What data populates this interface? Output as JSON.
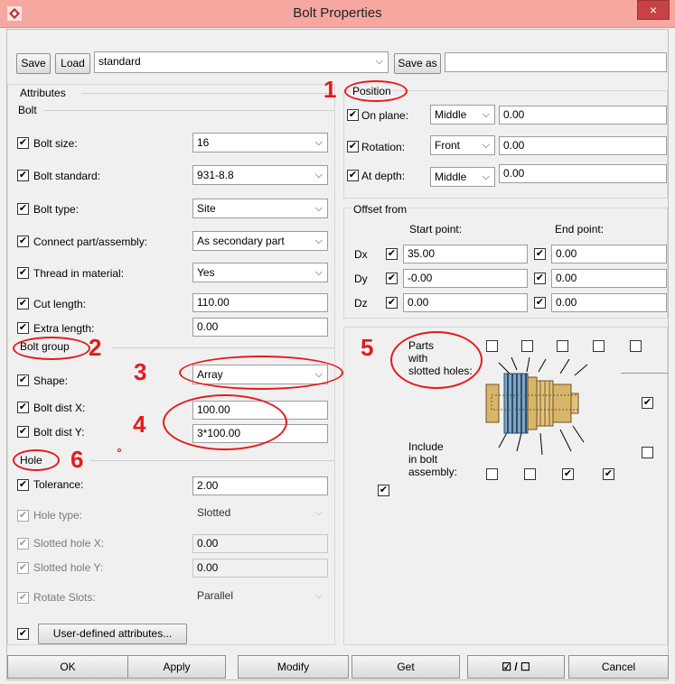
{
  "window": {
    "title": "Bolt Properties",
    "close_glyph": "×"
  },
  "toolbar": {
    "save_label": "Save",
    "load_label": "Load",
    "preset_value": "standard",
    "save_as_label": "Save as",
    "save_as_value": ""
  },
  "attributes": {
    "section_label": "Attributes",
    "bolt_label": "Bolt"
  },
  "bolt_rows": [
    {
      "label": "Bolt size:",
      "value": "16"
    },
    {
      "label": "Bolt standard:",
      "value": "931-8.8"
    },
    {
      "label": "Bolt type:",
      "value": "Site"
    },
    {
      "label": "Connect part/assembly:",
      "value": "As secondary part"
    },
    {
      "label": "Thread in material:",
      "value": "Yes"
    },
    {
      "label": "Cut length:",
      "value": "110.00"
    },
    {
      "label": "Extra length:",
      "value": "0.00"
    }
  ],
  "bolt_group": {
    "label": "Bolt group",
    "shape_label": "Shape:",
    "shape_value": "Array",
    "dist_x_label": "Bolt dist X:",
    "dist_x_value": "100.00",
    "dist_y_label": "Bolt dist Y:",
    "dist_y_value": "3*100.00"
  },
  "hole": {
    "label": "Hole",
    "tolerance_label": "Tolerance:",
    "tolerance_value": "2.00",
    "hole_type_label": "Hole type:",
    "hole_type_value": "Slotted",
    "slotted_x_label": "Slotted hole X:",
    "slotted_x_value": "0.00",
    "slotted_y_label": "Slotted hole Y:",
    "slotted_y_value": "0.00",
    "rotate_label": "Rotate Slots:",
    "rotate_value": "Parallel"
  },
  "user_defined_label": "User-defined attributes...",
  "position": {
    "label": "Position",
    "on_plane_label": "On plane:",
    "on_plane_value": "Middle",
    "on_plane_num": "0.00",
    "rotation_label": "Rotation:",
    "rotation_value": "Front",
    "rotation_num": "0.00",
    "depth_label": "At depth:",
    "depth_value": "Middle",
    "depth_num": "0.00"
  },
  "offset": {
    "label": "Offset from",
    "start_label": "Start point:",
    "end_label": "End point:",
    "rows": [
      {
        "axis": "Dx",
        "start": "35.00",
        "end": "0.00"
      },
      {
        "axis": "Dy",
        "start": "-0.00",
        "end": "0.00"
      },
      {
        "axis": "Dz",
        "start": "0.00",
        "end": "0.00"
      }
    ]
  },
  "slotted": {
    "parts_label_1": "Parts",
    "parts_label_2": "with",
    "parts_label_3": "slotted holes:",
    "include_label_1": "Include",
    "include_label_2": "in bolt",
    "include_label_3": "assembly:"
  },
  "annotations": [
    "1",
    "2",
    "3",
    "4",
    "5",
    "6"
  ],
  "footer": {
    "ok": "OK",
    "apply": "Apply",
    "modify": "Modify",
    "get": "Get",
    "toggle": "☑ / ☐",
    "cancel": "Cancel"
  },
  "check_glyph": "✔",
  "dropdown_glyph": "⌵"
}
